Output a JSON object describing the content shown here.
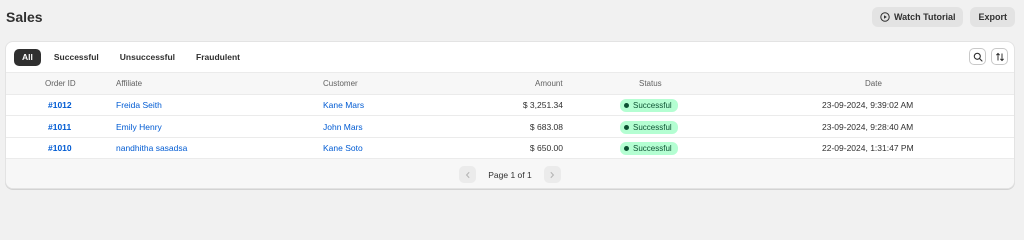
{
  "page": {
    "title": "Sales",
    "watch_tutorial_label": "Watch Tutorial",
    "export_label": "Export"
  },
  "tabs": [
    {
      "label": "All",
      "active": true
    },
    {
      "label": "Successful",
      "active": false
    },
    {
      "label": "Unsuccessful",
      "active": false
    },
    {
      "label": "Fraudulent",
      "active": false
    }
  ],
  "toolbar": {
    "search_icon": "search-icon",
    "sort_icon": "sort-icon"
  },
  "table": {
    "headers": {
      "order_id": "Order ID",
      "affiliate": "Affiliate",
      "customer": "Customer",
      "amount": "Amount",
      "status": "Status",
      "date": "Date"
    },
    "rows": [
      {
        "order_id": "#1012",
        "affiliate": "Freida Seith",
        "customer": "Kane Mars",
        "amount": "$ 3,251.34",
        "status": "Successful",
        "date": "23-09-2024, 9:39:02 AM"
      },
      {
        "order_id": "#1011",
        "affiliate": "Emily Henry",
        "customer": "John Mars",
        "amount": "$ 683.08",
        "status": "Successful",
        "date": "23-09-2024, 9:28:40 AM"
      },
      {
        "order_id": "#1010",
        "affiliate": "nandhitha sasadsa",
        "customer": "Kane Soto",
        "amount": "$ 650.00",
        "status": "Successful",
        "date": "22-09-2024, 1:31:47 PM"
      }
    ]
  },
  "pagination": {
    "label": "Page 1 of 1"
  },
  "colors": {
    "accent_link": "#005bd3",
    "status_success_bg": "#b4fed2",
    "status_success_text": "#0c5132",
    "active_tab_bg": "#303030"
  }
}
